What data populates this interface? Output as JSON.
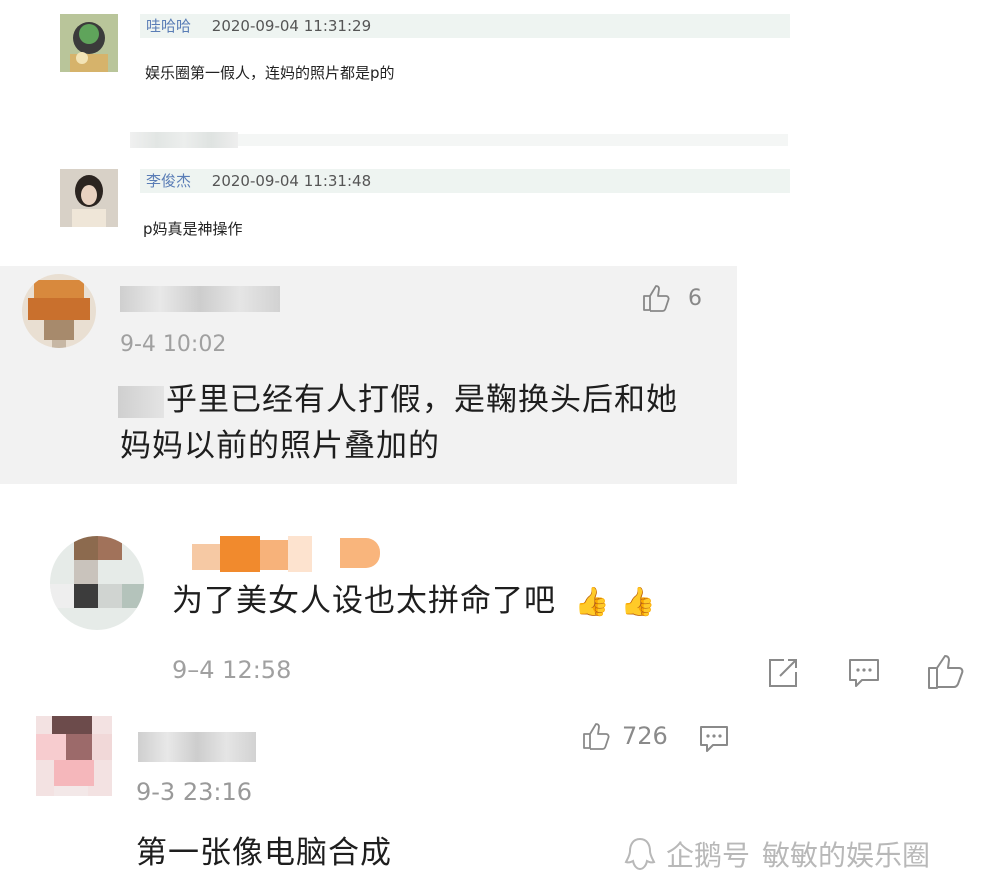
{
  "comments_small": [
    {
      "username": "哇哈哈",
      "timestamp": "2020-09-04 11:31:29",
      "text": "娱乐圈第一假人，连妈的照片都是p的"
    },
    {
      "username": "李俊杰",
      "timestamp": "2020-09-04 11:31:48",
      "text": "p妈真是神操作"
    }
  ],
  "comment_large_1": {
    "like_count": "6",
    "timestamp": "9-4 10:02",
    "text_line1": "乎里已经有人打假，是鞠换头后和她",
    "text_line2": "妈妈以前的照片叠加的"
  },
  "comment_large_2": {
    "text": "为了美女人设也太拼命了吧",
    "emoji": "👍 👍",
    "timestamp": "9–4 12:58"
  },
  "comment_large_3": {
    "like_count": "726",
    "timestamp": "9-3 23:16",
    "text": "第一张像电脑合成"
  },
  "watermark": {
    "brand": "企鹅号",
    "author": "敏敏的娱乐圈"
  },
  "icons": [
    "thumbs-up-icon",
    "share-icon",
    "comment-icon",
    "penguin-logo"
  ],
  "colors": {
    "username_blue": "#5a7db6",
    "meta_gray": "#a0a0a0",
    "panel_gray": "#f2f2f2",
    "header_tint": "#eef4f1"
  }
}
